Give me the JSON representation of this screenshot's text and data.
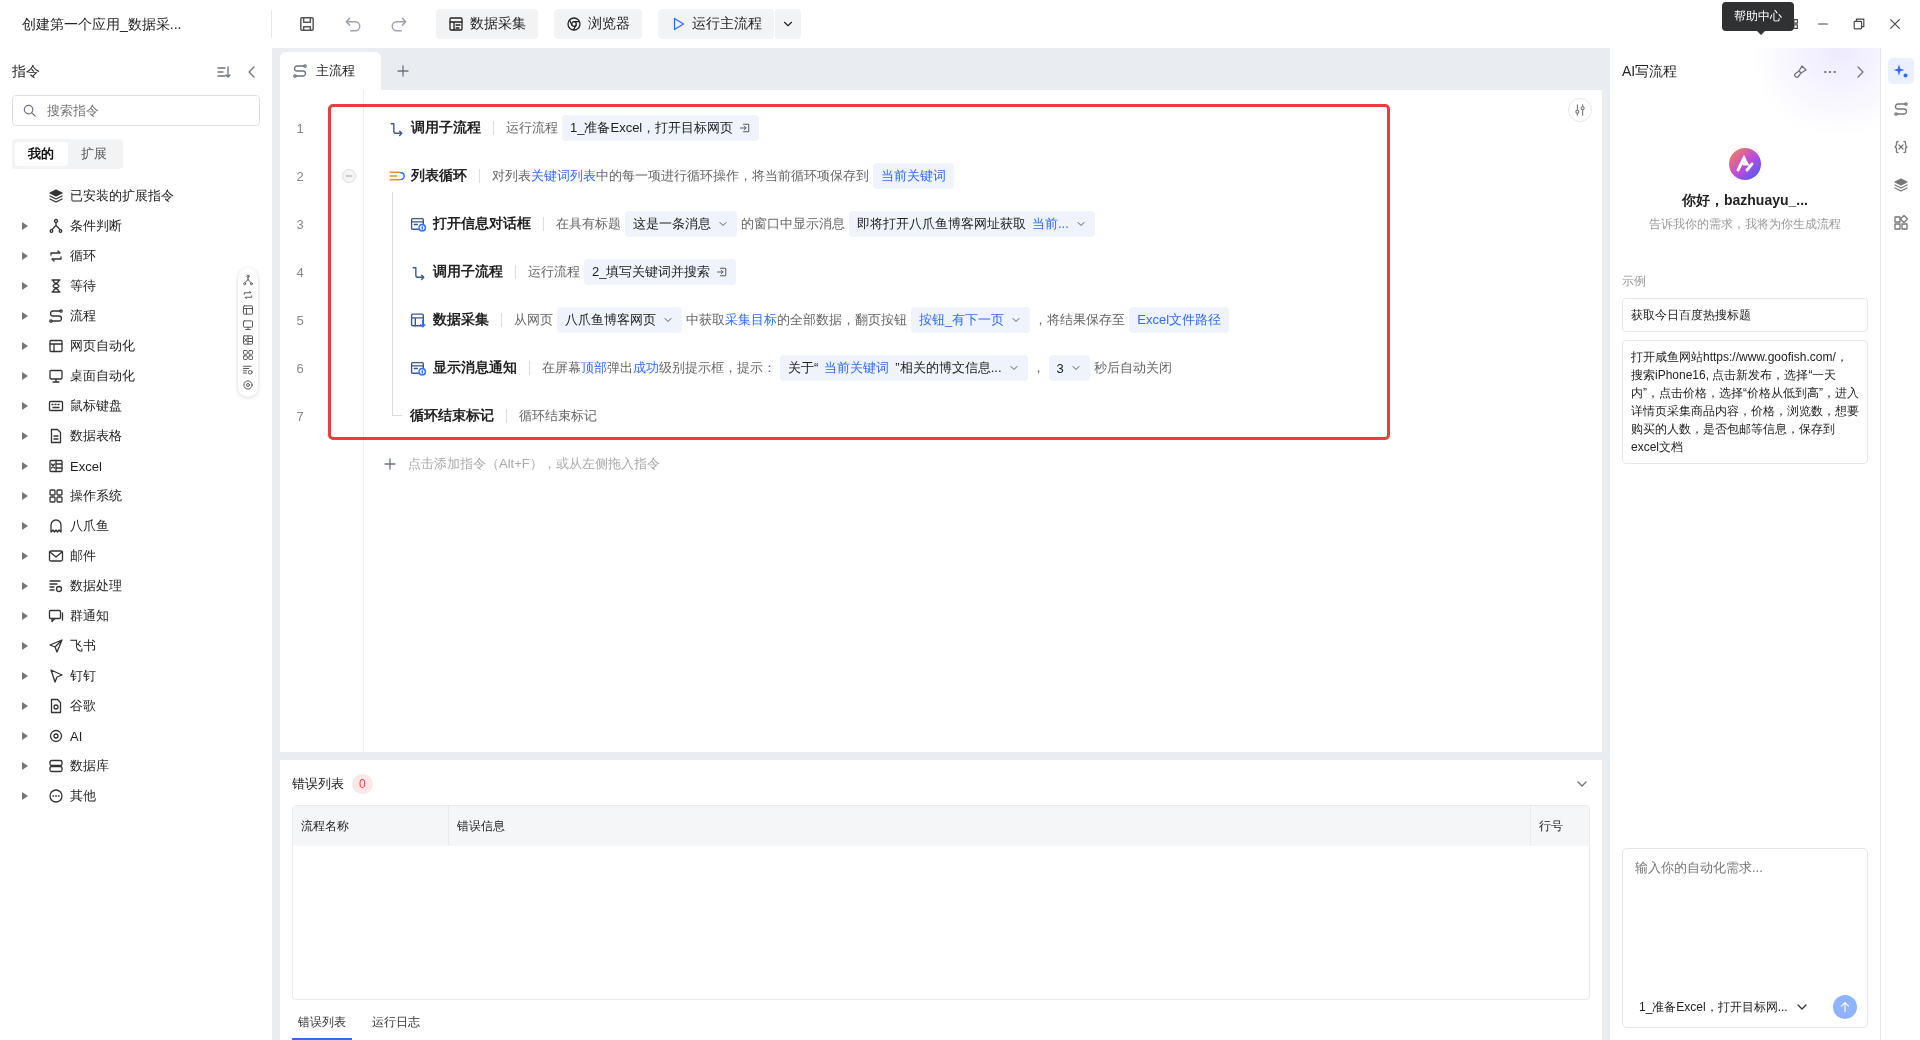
{
  "window": {
    "title": "创建第一个应用_数据采..."
  },
  "toolbar": {
    "buttons": [
      {
        "kind": "collect",
        "label": "数据采集"
      },
      {
        "kind": "browser",
        "label": "浏览器"
      },
      {
        "kind": "run",
        "label": "运行主流程"
      }
    ]
  },
  "tooltip": {
    "text": "帮助中心"
  },
  "sidebar": {
    "title": "指令",
    "search": {
      "placeholder": "搜索指令"
    },
    "tabs": [
      {
        "label": "我的",
        "selected": true
      },
      {
        "label": "扩展",
        "selected": false
      }
    ],
    "items": [
      {
        "kind": "group",
        "label": "已安装的扩展指令"
      },
      {
        "kind": "category",
        "label": "条件判断",
        "expanded": false
      },
      {
        "kind": "category",
        "label": "循环",
        "expanded": false
      },
      {
        "kind": "category",
        "label": "等待",
        "expanded": false
      },
      {
        "kind": "category",
        "label": "流程",
        "expanded": false
      },
      {
        "kind": "category",
        "label": "网页自动化",
        "expanded": false
      },
      {
        "kind": "category",
        "label": "桌面自动化",
        "expanded": false
      },
      {
        "kind": "category",
        "label": "鼠标键盘",
        "expanded": false
      },
      {
        "kind": "category",
        "label": "数据表格",
        "expanded": false
      },
      {
        "kind": "category",
        "label": "Excel",
        "expanded": false
      },
      {
        "kind": "category",
        "label": "操作系统",
        "expanded": false
      },
      {
        "kind": "category",
        "label": "八爪鱼",
        "expanded": false
      },
      {
        "kind": "category",
        "label": "邮件",
        "expanded": false
      },
      {
        "kind": "category",
        "label": "数据处理",
        "expanded": false
      },
      {
        "kind": "category",
        "label": "群通知",
        "expanded": false
      },
      {
        "kind": "category",
        "label": "飞书",
        "expanded": false
      },
      {
        "kind": "category",
        "label": "钉钉",
        "expanded": false
      },
      {
        "kind": "category",
        "label": "谷歌",
        "expanded": false
      },
      {
        "kind": "category",
        "label": "AI",
        "expanded": false
      },
      {
        "kind": "category",
        "label": "数据库",
        "expanded": false
      },
      {
        "kind": "category",
        "label": "其他",
        "expanded": false
      }
    ]
  },
  "editor": {
    "tabs": [
      {
        "label": "主流程",
        "selected": true
      }
    ],
    "flow": {
      "highlighted": true,
      "steps": [
        {
          "line": "1",
          "kind": "subflow",
          "title": "调用子流程",
          "parts": [
            {
              "kind": "text",
              "text": "运行流程"
            },
            {
              "kind": "flow_ref",
              "segments": [
                {
                  "kind": "plain",
                  "text": "1_准备Excel，打开目标网页"
                }
              ]
            }
          ]
        },
        {
          "line": "2",
          "kind": "loop",
          "title": "列表循环",
          "expanded": true,
          "parts": [
            {
              "kind": "text",
              "text": "对列表"
            },
            {
              "kind": "var",
              "text": "关键词列表"
            },
            {
              "kind": "text",
              "text": "中的每一项进行循环操作，将当前循环项保存到"
            },
            {
              "kind": "chip",
              "segments": [
                {
                  "kind": "var",
                  "text": "当前关键词"
                }
              ]
            }
          ],
          "children": [
            {
              "line": "3",
              "kind": "dialog",
              "title": "打开信息对话框",
              "parts": [
                {
                  "kind": "text",
                  "text": "在具有标题"
                },
                {
                  "kind": "select",
                  "segments": [
                    {
                      "kind": "plain",
                      "text": "这是一条消息"
                    }
                  ]
                },
                {
                  "kind": "text",
                  "text": "的窗口中显示消息"
                },
                {
                  "kind": "select",
                  "segments": [
                    {
                      "kind": "plain",
                      "text": "即将打开八爪鱼博客网址获取"
                    },
                    {
                      "kind": "var",
                      "text": "当前..."
                    }
                  ]
                }
              ]
            },
            {
              "line": "4",
              "kind": "subflow",
              "title": "调用子流程",
              "parts": [
                {
                  "kind": "text",
                  "text": "运行流程"
                },
                {
                  "kind": "flow_ref",
                  "segments": [
                    {
                      "kind": "plain",
                      "text": "2_填写关键词并搜索"
                    }
                  ]
                }
              ]
            },
            {
              "line": "5",
              "kind": "collect",
              "title": "数据采集",
              "parts": [
                {
                  "kind": "text",
                  "text": "从网页"
                },
                {
                  "kind": "select",
                  "segments": [
                    {
                      "kind": "plain",
                      "text": "八爪鱼博客网页"
                    }
                  ]
                },
                {
                  "kind": "text",
                  "text": "中获取"
                },
                {
                  "kind": "var",
                  "text": "采集目标"
                },
                {
                  "kind": "text",
                  "text": "的全部数据，翻页按钮"
                },
                {
                  "kind": "select",
                  "segments": [
                    {
                      "kind": "var",
                      "text": "按钮_有下一页"
                    }
                  ]
                },
                {
                  "kind": "text",
                  "text": "，将结果保存至"
                },
                {
                  "kind": "chip",
                  "segments": [
                    {
                      "kind": "var",
                      "text": "Excel文件路径"
                    }
                  ]
                }
              ]
            },
            {
              "line": "6",
              "kind": "notify",
              "title": "显示消息通知",
              "parts": [
                {
                  "kind": "text",
                  "text": "在屏幕"
                },
                {
                  "kind": "var",
                  "text": "顶部"
                },
                {
                  "kind": "text",
                  "text": "弹出"
                },
                {
                  "kind": "var",
                  "text": "成功"
                },
                {
                  "kind": "text",
                  "text": "级别提示框，提示："
                },
                {
                  "kind": "select",
                  "segments": [
                    {
                      "kind": "plain",
                      "text": "关于“"
                    },
                    {
                      "kind": "var",
                      "text": "当前关键词"
                    },
                    {
                      "kind": "plain",
                      "text": "”相关的博文信息..."
                    }
                  ]
                },
                {
                  "kind": "text",
                  "text": "，"
                },
                {
                  "kind": "select",
                  "segments": [
                    {
                      "kind": "plain",
                      "text": "3"
                    }
                  ]
                },
                {
                  "kind": "text",
                  "text": "秒后自动关闭"
                }
              ]
            },
            {
              "line": "7",
              "kind": "loop_end",
              "title": "循环结束标记",
              "parts": [
                {
                  "kind": "text",
                  "text": "循环结束标记"
                }
              ]
            }
          ]
        }
      ]
    },
    "add_hint": "点击添加指令（Alt+F），或从左侧拖入指令"
  },
  "error_panel": {
    "title": "错误列表",
    "count": "0",
    "columns": [
      "流程名称",
      "错误信息",
      "行号"
    ],
    "tabs": [
      {
        "label": "错误列表",
        "selected": true
      },
      {
        "label": "运行日志",
        "selected": false
      }
    ]
  },
  "ai_panel": {
    "title": "AI写流程",
    "greeting": "你好，bazhuayu_...",
    "subtitle": "告诉我你的需求，我将为你生成流程",
    "examples_label": "示例",
    "examples": [
      "获取今日百度热搜标题",
      "打开咸鱼网站https://www.goofish.com/，搜索iPhone16, 点击新发布，选择“一天内”，点击价格，选择“价格从低到高”，进入详情页采集商品内容，价格，浏览数，想要购买的人数，是否包邮等信息，保存到excel文档"
    ],
    "input": {
      "placeholder": "输入你的自动化需求..."
    },
    "flow_select": "1_准备Excel，打开目标网..."
  },
  "rail": [
    {
      "selected": true
    },
    {
      "selected": false
    },
    {
      "selected": false
    },
    {
      "selected": false
    },
    {
      "selected": false
    }
  ]
}
